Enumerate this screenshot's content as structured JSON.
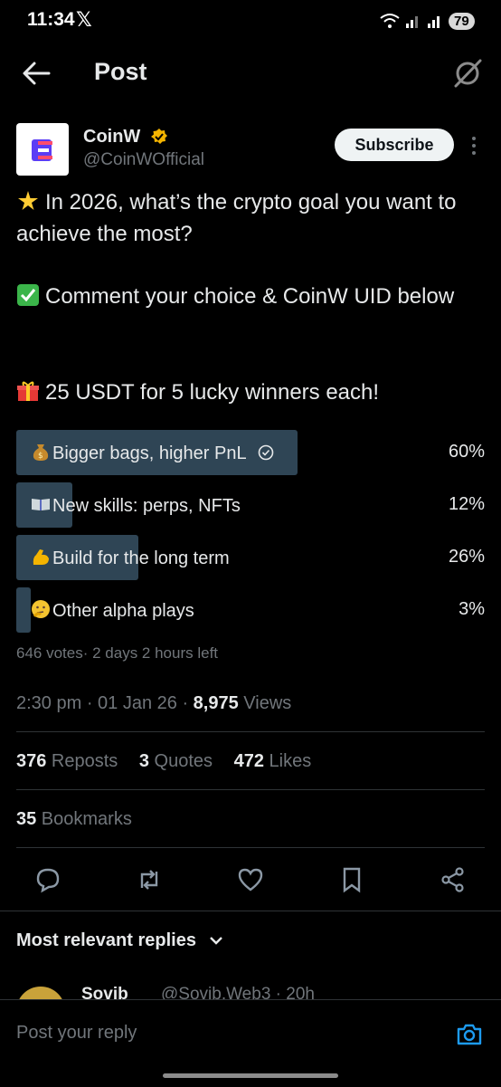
{
  "status_bar": {
    "time": "11:34",
    "x_logo": "𝕏",
    "battery": "79"
  },
  "header": {
    "title": "Post",
    "back_icon": "arrow-left-icon",
    "grok_icon": "grok-icon"
  },
  "author": {
    "name": "CoinW",
    "handle": "@CoinWOfficial",
    "subscribe_label": "Subscribe"
  },
  "post": {
    "line1": "In 2026, what’s the crypto goal you want to achieve the most?",
    "line2": "Comment your choice & CoinW UID below",
    "line3": "25 USDT for 5 lucky winners each!"
  },
  "poll": {
    "options": [
      {
        "emoji": "money-bag",
        "label": "Bigger bags, higher PnL",
        "pct": "60%",
        "value": 0.6,
        "selected": true
      },
      {
        "emoji": "open-book",
        "label": "New skills: perps, NFTs",
        "pct": "12%",
        "value": 0.12,
        "selected": false
      },
      {
        "emoji": "flexed-biceps",
        "label": "Build for the long term",
        "pct": "26%",
        "value": 0.26,
        "selected": false
      },
      {
        "emoji": "thinking-face",
        "label": "Other alpha plays",
        "pct": "3%",
        "value": 0.03,
        "selected": false
      }
    ],
    "meta": "646 votes· 2 days 2 hours left"
  },
  "meta": {
    "time": "2:30 pm · 01 Jan 26 · ",
    "views_count": "8,975",
    "views_label": " Views"
  },
  "stats": {
    "reposts_count": "376",
    "reposts_label": " Reposts",
    "quotes_count": "3",
    "quotes_label": " Quotes",
    "likes_count": "472",
    "likes_label": " Likes",
    "bookmarks_count": "35",
    "bookmarks_label": " Bookmarks"
  },
  "replies": {
    "heading": "Most relevant replies",
    "first_name": "Sovib",
    "first_handle": "@Sovib.Web3 · 20h"
  },
  "reply_bar": {
    "placeholder": "Post your reply"
  },
  "colors": {
    "accent": "#1d9bf0",
    "poll_fill": "#2f4555",
    "verified": "#f4b400",
    "background": "#000000"
  }
}
